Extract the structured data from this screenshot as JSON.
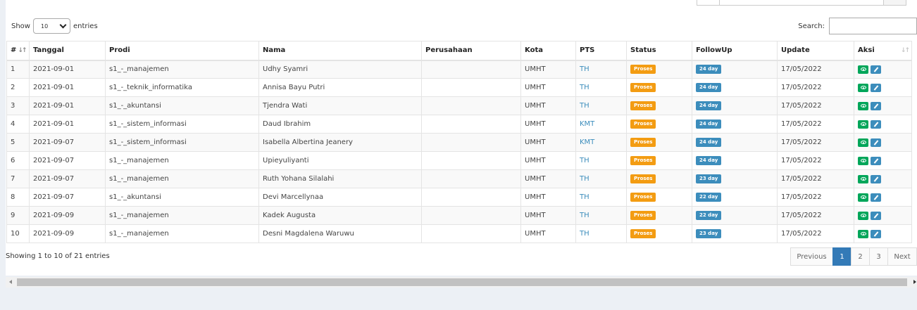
{
  "length": {
    "show_label": "Show",
    "value": "10",
    "entries_label": "entries"
  },
  "search": {
    "label": "Search:",
    "value": ""
  },
  "table": {
    "columns": [
      "#",
      "Tanggal",
      "Prodi",
      "Nama",
      "Perusahaan",
      "Kota",
      "PTS",
      "Status",
      "FollowUp",
      "Update",
      "Aksi"
    ],
    "rows": [
      {
        "no": "1",
        "tanggal": "2021-09-01",
        "prodi": "s1_-_manajemen",
        "nama": "Udhy Syamri",
        "perusahaan": "",
        "kota": "UMHT",
        "pts": "TH",
        "status": "Proses",
        "followup": "24 day",
        "update": "17/05/2022"
      },
      {
        "no": "2",
        "tanggal": "2021-09-01",
        "prodi": "s1_-_teknik_informatika",
        "nama": "Annisa Bayu Putri",
        "perusahaan": "",
        "kota": "UMHT",
        "pts": "TH",
        "status": "Proses",
        "followup": "24 day",
        "update": "17/05/2022"
      },
      {
        "no": "3",
        "tanggal": "2021-09-01",
        "prodi": "s1_-_akuntansi",
        "nama": "Tjendra Wati",
        "perusahaan": "",
        "kota": "UMHT",
        "pts": "TH",
        "status": "Proses",
        "followup": "24 day",
        "update": "17/05/2022"
      },
      {
        "no": "4",
        "tanggal": "2021-09-01",
        "prodi": "s1_-_sistem_informasi",
        "nama": "Daud Ibrahim",
        "perusahaan": "",
        "kota": "UMHT",
        "pts": "KMT",
        "status": "Proses",
        "followup": "24 day",
        "update": "17/05/2022"
      },
      {
        "no": "5",
        "tanggal": "2021-09-07",
        "prodi": "s1_-_sistem_informasi",
        "nama": "Isabella Albertina Jeanery",
        "perusahaan": "",
        "kota": "UMHT",
        "pts": "KMT",
        "status": "Proses",
        "followup": "24 day",
        "update": "17/05/2022"
      },
      {
        "no": "6",
        "tanggal": "2021-09-07",
        "prodi": "s1_-_manajemen",
        "nama": "Upieyuliyanti",
        "perusahaan": "",
        "kota": "UMHT",
        "pts": "TH",
        "status": "Proses",
        "followup": "24 day",
        "update": "17/05/2022"
      },
      {
        "no": "7",
        "tanggal": "2021-09-07",
        "prodi": "s1_-_manajemen",
        "nama": "Ruth Yohana Silalahi",
        "perusahaan": "",
        "kota": "UMHT",
        "pts": "TH",
        "status": "Proses",
        "followup": "23 day",
        "update": "17/05/2022"
      },
      {
        "no": "8",
        "tanggal": "2021-09-07",
        "prodi": "s1_-_akuntansi",
        "nama": "Devi Marcellynaa",
        "perusahaan": "",
        "kota": "UMHT",
        "pts": "TH",
        "status": "Proses",
        "followup": "22 day",
        "update": "17/05/2022"
      },
      {
        "no": "9",
        "tanggal": "2021-09-09",
        "prodi": "s1_-_manajemen",
        "nama": "Kadek Augusta",
        "perusahaan": "",
        "kota": "UMHT",
        "pts": "TH",
        "status": "Proses",
        "followup": "22 day",
        "update": "17/05/2022"
      },
      {
        "no": "10",
        "tanggal": "2021-09-09",
        "prodi": "s1_-_manajemen",
        "nama": "Desni Magdalena Waruwu",
        "perusahaan": "",
        "kota": "UMHT",
        "pts": "TH",
        "status": "Proses",
        "followup": "23 day",
        "update": "17/05/2022"
      }
    ]
  },
  "info": "Showing 1 to 10 of 21 entries",
  "pagination": {
    "previous": "Previous",
    "pages": [
      "1",
      "2",
      "3"
    ],
    "active": "1",
    "next": "Next"
  },
  "icons": {
    "view": "eye-icon",
    "edit": "pencil-icon",
    "sort": "sort-icon"
  },
  "colors": {
    "status_badge": "#f39c12",
    "followup_badge": "#3c8dbc",
    "view_button": "#00a65a",
    "edit_button": "#3c8dbc",
    "link": "#3c8dbc"
  }
}
